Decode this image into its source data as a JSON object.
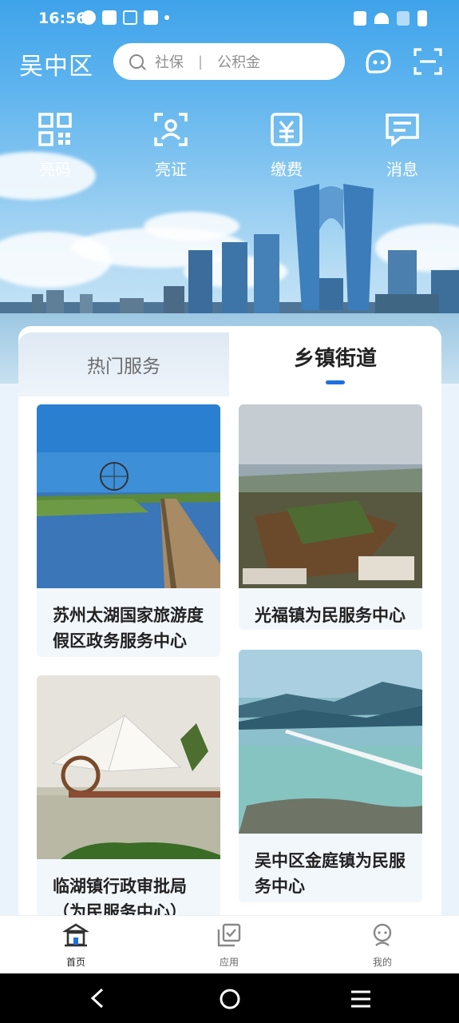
{
  "status_bar": {
    "time": "16:56"
  },
  "header": {
    "region": "吴中区",
    "search": {
      "placeholder_1": "社保",
      "separator": "|",
      "placeholder_2": "公积金"
    },
    "right_icons": [
      "chatbot-icon",
      "scan-icon"
    ]
  },
  "quick_actions": [
    {
      "label": "亮码",
      "icon": "qr-code-icon"
    },
    {
      "label": "亮证",
      "icon": "id-card-icon"
    },
    {
      "label": "缴费",
      "icon": "payment-icon"
    },
    {
      "label": "消息",
      "icon": "message-icon"
    }
  ],
  "tabs": [
    {
      "label": "热门服务",
      "active": false
    },
    {
      "label": "乡镇街道",
      "active": true
    }
  ],
  "cards": [
    {
      "title": "苏州太湖国家旅游度假区政务服务中心"
    },
    {
      "title": "光福镇为民服务中心"
    },
    {
      "title": "临湖镇行政审批局（为民服务中心）"
    },
    {
      "title": "吴中区金庭镇为民服务中心"
    }
  ],
  "bottom_nav": [
    {
      "label": "首页",
      "icon": "home-icon",
      "active": true
    },
    {
      "label": "应用",
      "icon": "apps-icon",
      "active": false
    },
    {
      "label": "我的",
      "icon": "profile-icon",
      "active": false
    }
  ],
  "colors": {
    "accent": "#1e6fe0",
    "sky": "#4aa8ec"
  }
}
